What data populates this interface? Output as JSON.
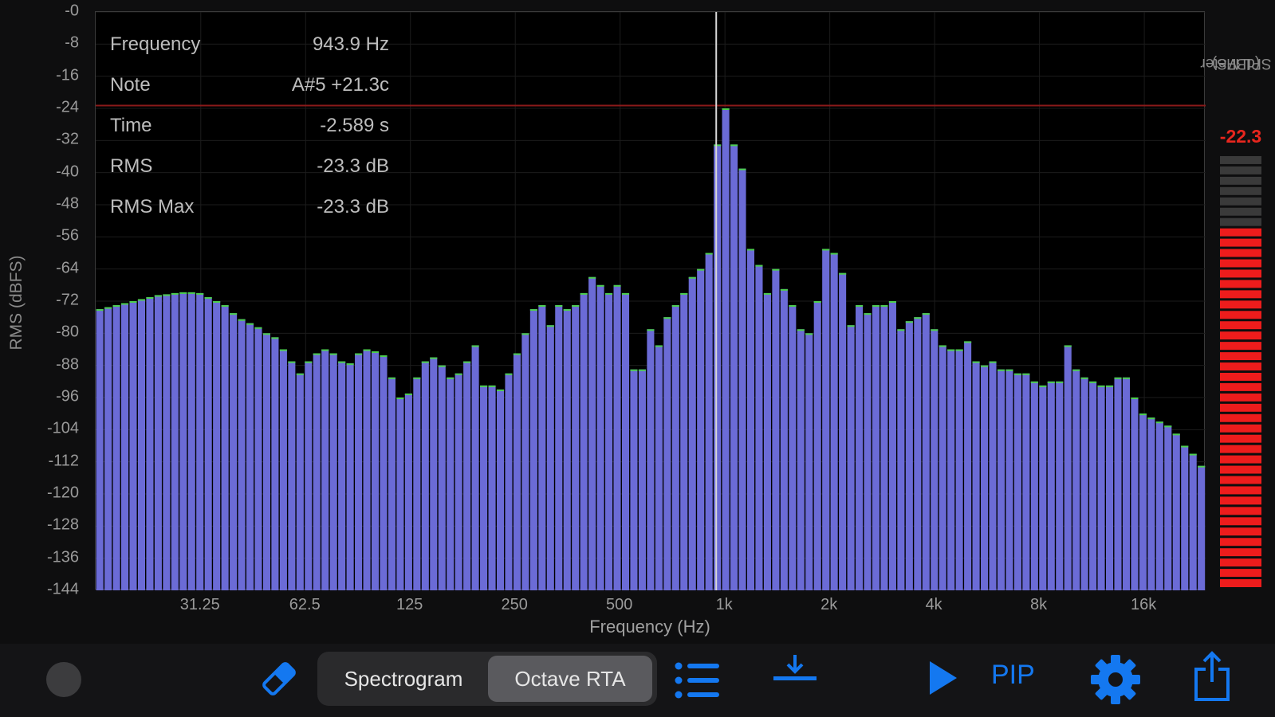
{
  "chart_data": {
    "type": "bar",
    "title": "",
    "ylabel": "RMS (dBFS)",
    "xlabel": "Frequency (Hz)",
    "ylim": [
      -144,
      0
    ],
    "y_ticks": [
      "-0",
      "-8",
      "-16",
      "-24",
      "-32",
      "-40",
      "-48",
      "-56",
      "-64",
      "-72",
      "-80",
      "-88",
      "-96",
      "-104",
      "-112",
      "-120",
      "-128",
      "-136",
      "-144"
    ],
    "x_ticks": [
      "31.25",
      "62.5",
      "125",
      "250",
      "500",
      "1k",
      "2k",
      "4k",
      "8k",
      "16k"
    ],
    "x_scale": "log",
    "xlim_hz": [
      15.6,
      24000
    ],
    "series": [
      {
        "values": [
          -74,
          -73.5,
          -73,
          -72.5,
          -72,
          -71.5,
          -71,
          -70.5,
          -70.3,
          -70,
          -69.8,
          -69.8,
          -70,
          -71,
          -72,
          -73,
          -75,
          -76.5,
          -77.5,
          -78.5,
          -80,
          -81,
          -84,
          -87,
          -90,
          -87,
          -85,
          -84,
          -85,
          -87,
          -87.5,
          -85,
          -84,
          -84.5,
          -85.5,
          -91,
          -96,
          -95,
          -91,
          -87,
          -86,
          -88,
          -91,
          -90,
          -87,
          -83,
          -93,
          -93,
          -94,
          -90,
          -85,
          -80,
          -74,
          -73,
          -78,
          -73,
          -74,
          -73,
          -70,
          -66,
          -68,
          -70,
          -68,
          -70,
          -89,
          -89,
          -79,
          -83,
          -76,
          -73,
          -70,
          -66,
          -64,
          -60,
          -33,
          -24,
          -33,
          -39,
          -59,
          -63,
          -70,
          -64,
          -69,
          -73,
          -79,
          -80,
          -72,
          -59,
          -60,
          -65,
          -78,
          -73,
          -75,
          -73,
          -73,
          -72,
          -79,
          -77,
          -76,
          -75,
          -79,
          -83,
          -84,
          -84,
          -82,
          -87,
          -88,
          -87,
          -89,
          -89,
          -90,
          -90,
          -92,
          -93,
          -92,
          -92,
          -83,
          -89,
          -91,
          -92,
          -93,
          -93,
          -91,
          -91,
          -96,
          -100,
          -101,
          -102,
          -103,
          -105,
          -108,
          -110,
          -113
        ]
      }
    ],
    "marker_line_db": -23.3,
    "cursor_hz": 943.9
  },
  "readout": [
    {
      "label": "Frequency",
      "value": "943.9 Hz"
    },
    {
      "label": "Note",
      "value": "A#5 +21.3c"
    },
    {
      "label": "Time",
      "value": "-2.589 s"
    },
    {
      "label": "RMS",
      "value": "-23.3 dB"
    },
    {
      "label": "RMS Max",
      "value": "-23.3 dB"
    }
  ],
  "spl_meter": {
    "title_line1": "SPL Meter",
    "title_line2": "(dBFS)",
    "value_text": "-22.3",
    "level_db": -22.3,
    "range_db": [
      -144,
      0
    ]
  },
  "toolbar": {
    "record_icon": "record-circle-icon",
    "eraser_icon": "eraser-icon",
    "tabs": [
      {
        "label": "Spectrogram",
        "active": false
      },
      {
        "label": "Octave RTA",
        "active": true
      }
    ],
    "list_icon": "list-icon",
    "download_icon": "download-icon",
    "play_icon": "play-icon",
    "pip_label": "PIP",
    "settings_icon": "gear-icon",
    "share_icon": "share-icon"
  },
  "colors": {
    "bar": "#6b6bd6",
    "bar_top": "#4cd04c",
    "marker": "#8b1a1a",
    "accent": "#1478f0",
    "meter_on": "#ee1c1c",
    "meter_off": "#3a3a3a"
  }
}
